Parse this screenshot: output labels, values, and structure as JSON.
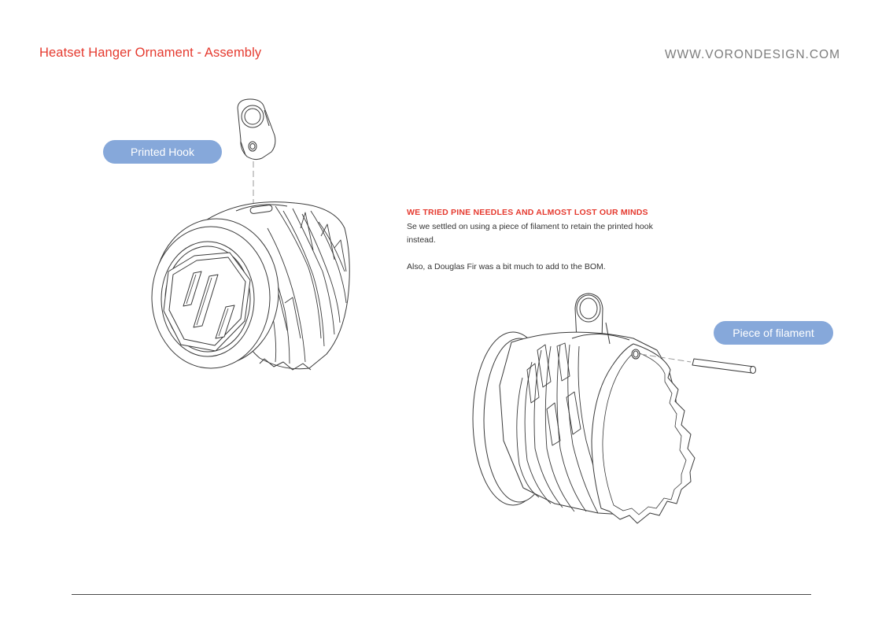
{
  "header": {
    "title": "Heatset Hanger Ornament - Assembly",
    "website": "WWW.VORONDESIGN.COM"
  },
  "callouts": {
    "printed_hook": "Printed Hook",
    "filament": "Piece of filament"
  },
  "note": {
    "heading": "WE TRIED PINE NEEDLES AND ALMOST LOST OUR MINDS",
    "body_1": "Se we settled on using a piece of filament to retain the printed hook instead.",
    "body_2": "Also,  a Douglas Fir was a bit much to add to the BOM."
  },
  "colors": {
    "title_red": "#e53a2f",
    "callout_blue": "#86a8da",
    "website_gray": "#7d7d7d"
  }
}
